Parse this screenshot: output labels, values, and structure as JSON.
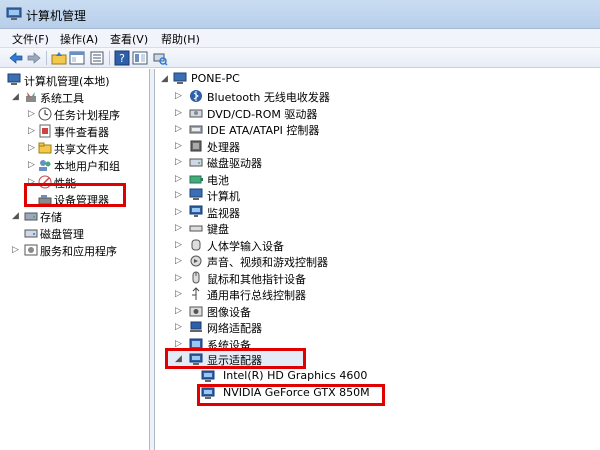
{
  "window": {
    "title": "计算机管理"
  },
  "menu": {
    "file": "文件(F)",
    "action": "操作(A)",
    "view": "查看(V)",
    "help": "帮助(H)"
  },
  "left_tree": {
    "root": "计算机管理(本地)",
    "system_tools": "系统工具",
    "task_scheduler": "任务计划程序",
    "event_viewer": "事件查看器",
    "shared_folders": "共享文件夹",
    "local_users": "本地用户和组",
    "performance": "性能",
    "device_manager": "设备管理器",
    "storage": "存储",
    "disk_management": "磁盘管理",
    "services": "服务和应用程序"
  },
  "device_tree": {
    "computer": "PONE-PC",
    "categories": [
      "Bluetooth 无线电收发器",
      "DVD/CD-ROM 驱动器",
      "IDE ATA/ATAPI 控制器",
      "处理器",
      "磁盘驱动器",
      "电池",
      "计算机",
      "监视器",
      "键盘",
      "人体学输入设备",
      "声音、视频和游戏控制器",
      "鼠标和其他指针设备",
      "通用串行总线控制器",
      "图像设备",
      "网络适配器",
      "系统设备"
    ],
    "display_adapters": "显示适配器",
    "adapters": [
      "Intel(R) HD Graphics 4600",
      "NVIDIA GeForce GTX 850M"
    ]
  },
  "colors": {
    "highlight": "#e00000",
    "titlebar": "#c9dcf2",
    "selection": "#e3ebf6"
  }
}
